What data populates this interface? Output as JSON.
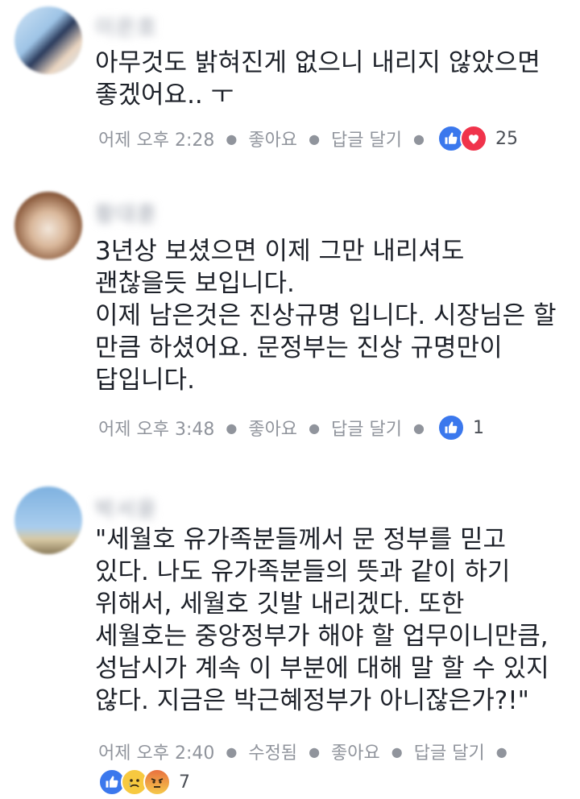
{
  "comments": [
    {
      "author": "이은호",
      "text": "아무것도 밝혀진게 없으니 내리지 않았으면\n좋겠어요.. ㅜ",
      "time": "어제 오후 2:28",
      "like_label": "좋아요",
      "reply_label": "답글 달기",
      "reactions": [
        "like",
        "love"
      ],
      "reaction_count": "25"
    },
    {
      "author": "황대훈",
      "text": "3년상 보셨으면 이제 그만 내리셔도\n괜찮을듯 보입니다.\n이제 남은것은 진상규명 입니다. 시장님은 할\n만큼 하셨어요. 문정부는 진상 규명만이\n답입니다.",
      "time": "어제 오후 3:48",
      "like_label": "좋아요",
      "reply_label": "답글 달기",
      "reactions": [
        "like"
      ],
      "reaction_count": "1"
    },
    {
      "author": "박서윤",
      "text": "\"세월호 유가족분들께서  문 정부를 믿고\n있다. 나도 유가족분들의 뜻과 같이 하기\n위해서, 세월호 깃발 내리겠다. 또한\n세월호는 중앙정부가 해야 할 업무이니만큼,\n성남시가 계속 이 부분에 대해 말 할 수 있지\n않다. 지금은 박근혜정부가 아니잖은가?!\"",
      "time": "어제 오후 2:40",
      "edited_label": "수정됨",
      "like_label": "좋아요",
      "reply_label": "답글 달기",
      "reactions": [
        "like",
        "sad",
        "angry"
      ],
      "reaction_count": "7"
    }
  ],
  "colors": {
    "like": "#3b78ed",
    "love": "#f0334b",
    "meta": "#90949c"
  }
}
